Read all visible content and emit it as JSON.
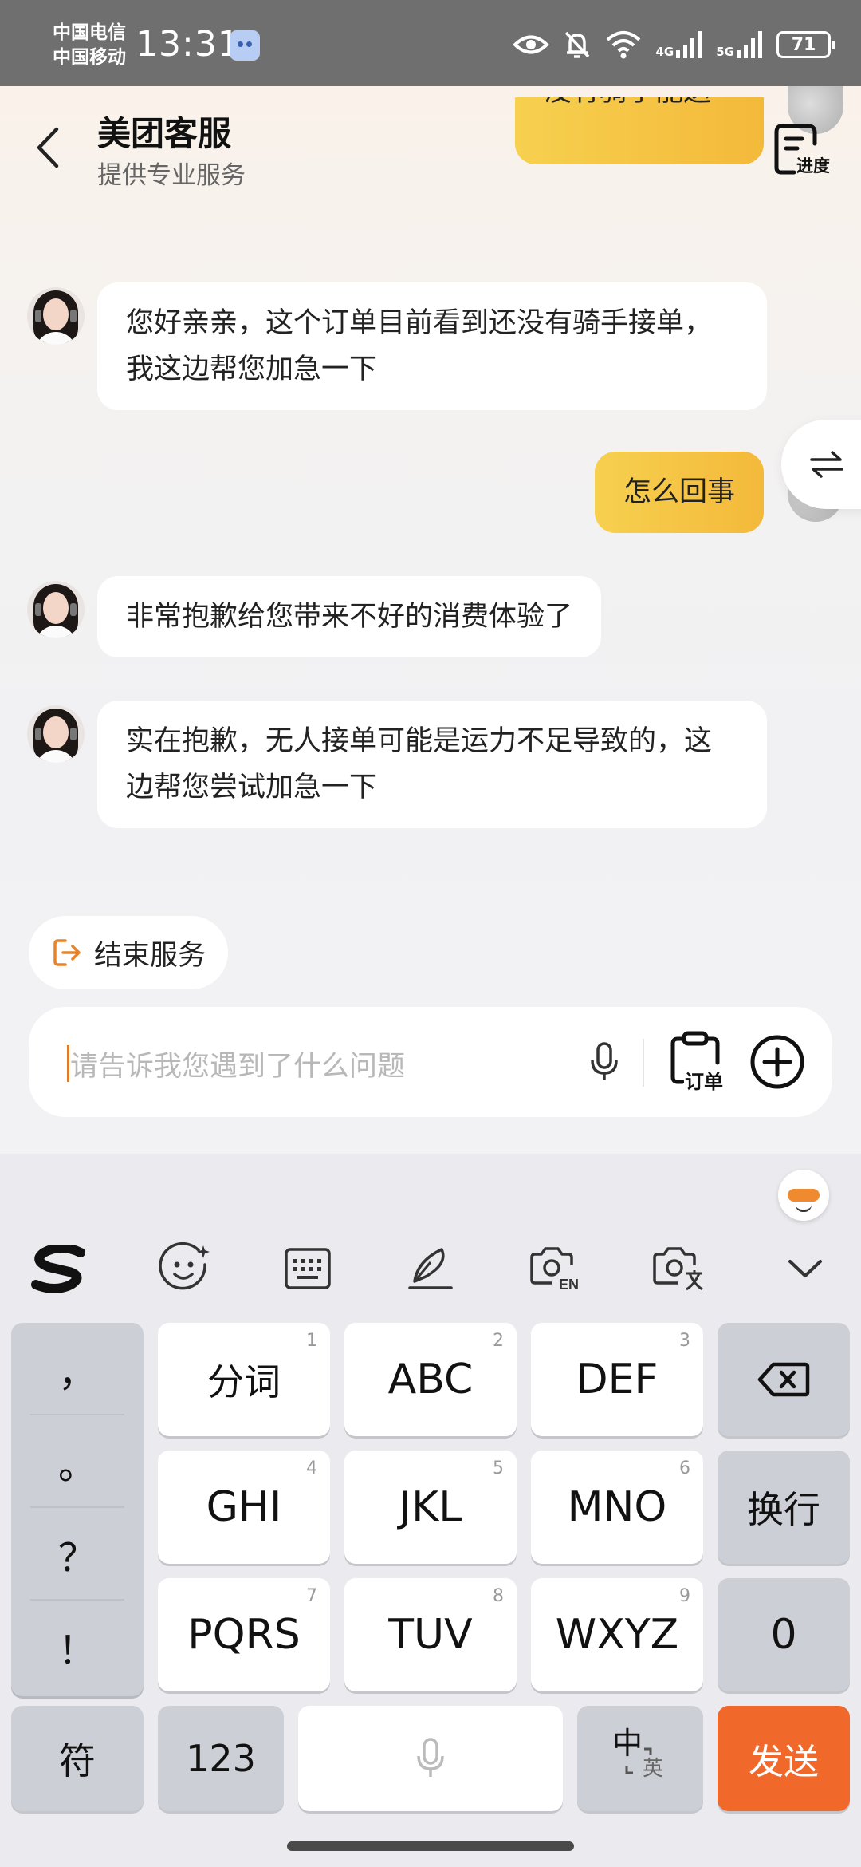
{
  "status_bar": {
    "carrier_1": "中国电信",
    "carrier_2": "中国移动",
    "time": "13:31",
    "network_1": "4G",
    "network_2": "5G",
    "battery": "71"
  },
  "header": {
    "title": "美团客服",
    "subtitle": "提供专业服务",
    "progress_label": "进度"
  },
  "messages": [
    {
      "side": "right",
      "text": "没有骑手能送"
    },
    {
      "side": "left",
      "text": "您好亲亲，这个订单目前看到还没有骑手接单，我这边帮您加急一下"
    },
    {
      "side": "right",
      "text": "怎么回事"
    },
    {
      "side": "left",
      "text": "非常抱歉给您带来不好的消费体验了"
    },
    {
      "side": "left",
      "text": "实在抱歉，无人接单可能是运力不足导致的，这边帮您尝试加急一下"
    }
  ],
  "end_service_label": "结束服务",
  "input": {
    "placeholder": "请告诉我您遇到了什么问题",
    "order_label": "订单"
  },
  "keyboard": {
    "toolbar_icons": [
      "sogou-logo-icon",
      "emoji-icon",
      "keyboard-icon",
      "handwriting-icon",
      "camera-en-icon",
      "camera-translate-icon",
      "collapse-icon"
    ],
    "punctuation": [
      "，",
      "。",
      "？",
      "！"
    ],
    "keys": [
      {
        "label": "分词",
        "num": "1"
      },
      {
        "label": "ABC",
        "num": "2"
      },
      {
        "label": "DEF",
        "num": "3"
      },
      {
        "label": "GHI",
        "num": "4"
      },
      {
        "label": "JKL",
        "num": "5"
      },
      {
        "label": "MNO",
        "num": "6"
      },
      {
        "label": "PQRS",
        "num": "7"
      },
      {
        "label": "TUV",
        "num": "8"
      },
      {
        "label": "WXYZ",
        "num": "9"
      }
    ],
    "newline_label": "换行",
    "zero_label": "0",
    "symbols_label": "符",
    "numbers_label": "123",
    "lang_primary": "中",
    "lang_secondary": "英",
    "send_label": "发送"
  },
  "colors": {
    "accent_orange": "#f1692a",
    "bubble_user": "#f5c443",
    "status_bar": "#6f6f6f"
  }
}
